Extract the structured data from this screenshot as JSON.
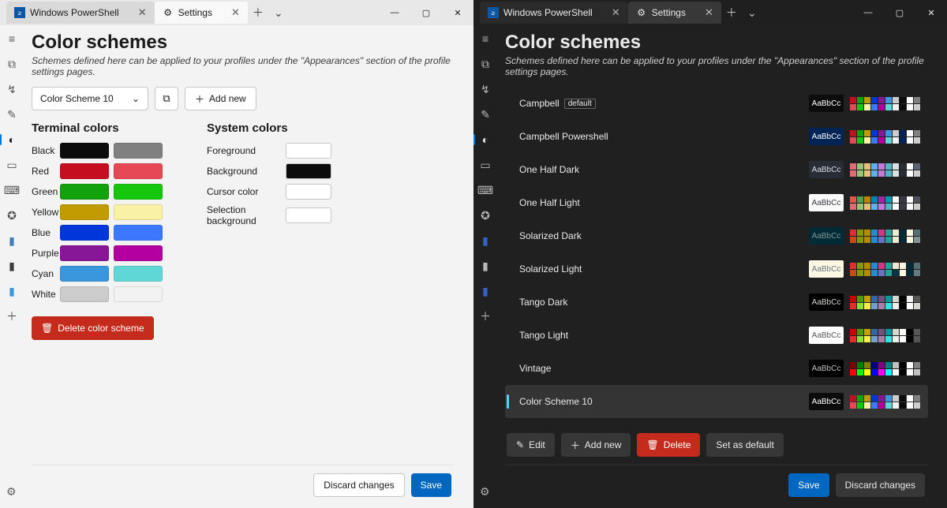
{
  "tabs": {
    "powershell": "Windows PowerShell",
    "settings": "Settings"
  },
  "page": {
    "title": "Color schemes",
    "subtitle": "Schemes defined here can be applied to your profiles under the \"Appearances\" section of the profile settings pages."
  },
  "left": {
    "dropdown_value": "Color Scheme 10",
    "add_new": "Add new",
    "section_terminal": "Terminal colors",
    "section_system": "System colors",
    "terminal_rows": [
      {
        "label": "Black",
        "c1": "#0c0c0c",
        "c2": "#808080"
      },
      {
        "label": "Red",
        "c1": "#c50f1f",
        "c2": "#e74856"
      },
      {
        "label": "Green",
        "c1": "#13a10e",
        "c2": "#16c60c"
      },
      {
        "label": "Yellow",
        "c1": "#c19c00",
        "c2": "#f9f1a5"
      },
      {
        "label": "Blue",
        "c1": "#0037da",
        "c2": "#3b78ff"
      },
      {
        "label": "Purple",
        "c1": "#881798",
        "c2": "#b4009e"
      },
      {
        "label": "Cyan",
        "c1": "#3a96dd",
        "c2": "#61d6d6"
      },
      {
        "label": "White",
        "c1": "#cccccc",
        "c2": "#f2f2f2"
      }
    ],
    "system_rows": [
      {
        "label": "Foreground",
        "color": "#ffffff"
      },
      {
        "label": "Background",
        "color": "#0c0c0c"
      },
      {
        "label": "Cursor color",
        "color": "#ffffff"
      },
      {
        "label": "Selection background",
        "color": "#ffffff"
      }
    ],
    "delete": "Delete color scheme",
    "discard": "Discard changes",
    "save": "Save"
  },
  "right": {
    "schemes": [
      {
        "name": "Campbell",
        "default": true,
        "preview_bg": "#0c0c0c",
        "preview_fg": "#ffffff",
        "palette": [
          "#c50f1f",
          "#13a10e",
          "#c19c00",
          "#0037da",
          "#881798",
          "#3a96dd",
          "#cccccc",
          "#0c0c0c",
          "#ffffff",
          "#808080",
          "#e74856",
          "#16c60c",
          "#f9f1a5",
          "#3b78ff",
          "#b4009e",
          "#61d6d6",
          "#f2f2f2",
          "#0c0c0c",
          "#ffffff",
          "#cccccc"
        ]
      },
      {
        "name": "Campbell Powershell",
        "preview_bg": "#012456",
        "preview_fg": "#ffffff",
        "palette": [
          "#c50f1f",
          "#13a10e",
          "#c19c00",
          "#0037da",
          "#881798",
          "#3a96dd",
          "#cccccc",
          "#012456",
          "#ffffff",
          "#808080",
          "#e74856",
          "#16c60c",
          "#f9f1a5",
          "#3b78ff",
          "#b4009e",
          "#61d6d6",
          "#f2f2f2",
          "#012456",
          "#ffffff",
          "#cccccc"
        ]
      },
      {
        "name": "One Half Dark",
        "preview_bg": "#282c34",
        "preview_fg": "#dcdfe4",
        "palette": [
          "#e06c75",
          "#98c379",
          "#e5c07b",
          "#61afef",
          "#c678dd",
          "#56b6c2",
          "#dcdfe4",
          "#282c34",
          "#ffffff",
          "#5a6374",
          "#e06c75",
          "#98c379",
          "#e5c07b",
          "#61afef",
          "#c678dd",
          "#56b6c2",
          "#dcdfe4",
          "#282c34",
          "#ffffff",
          "#cccccc"
        ]
      },
      {
        "name": "One Half Light",
        "preview_bg": "#fafafa",
        "preview_fg": "#383a42",
        "palette": [
          "#e45649",
          "#50a14f",
          "#c18401",
          "#0184bc",
          "#a626a4",
          "#0997b3",
          "#fafafa",
          "#383a42",
          "#ffffff",
          "#4f525d",
          "#df6c75",
          "#98c379",
          "#e4c07a",
          "#61afef",
          "#c577dd",
          "#56b5c1",
          "#ffffff",
          "#383a42",
          "#ffffff",
          "#cccccc"
        ]
      },
      {
        "name": "Solarized Dark",
        "preview_bg": "#002b36",
        "preview_fg": "#839496",
        "palette": [
          "#dc322f",
          "#859900",
          "#b58900",
          "#268bd2",
          "#d33682",
          "#2aa198",
          "#eee8d5",
          "#002b36",
          "#fdf6e3",
          "#586e75",
          "#cb4b16",
          "#859900",
          "#b58900",
          "#268bd2",
          "#6c71c4",
          "#2aa198",
          "#eee8d5",
          "#002b36",
          "#fdf6e3",
          "#839496"
        ]
      },
      {
        "name": "Solarized Light",
        "preview_bg": "#fdf6e3",
        "preview_fg": "#657b83",
        "palette": [
          "#dc322f",
          "#859900",
          "#b58900",
          "#268bd2",
          "#d33682",
          "#2aa198",
          "#eee8d5",
          "#fdf6e3",
          "#002b36",
          "#586e75",
          "#cb4b16",
          "#859900",
          "#b58900",
          "#268bd2",
          "#6c71c4",
          "#2aa198",
          "#073642",
          "#fdf6e3",
          "#002b36",
          "#657b83"
        ]
      },
      {
        "name": "Tango Dark",
        "preview_bg": "#000000",
        "preview_fg": "#d3d7cf",
        "palette": [
          "#cc0000",
          "#4e9a06",
          "#c4a000",
          "#3465a4",
          "#75507b",
          "#06989a",
          "#d3d7cf",
          "#000000",
          "#eeeeec",
          "#555753",
          "#ef2929",
          "#8ae234",
          "#fce94f",
          "#729fcf",
          "#ad7fa8",
          "#34e2e2",
          "#eeeeec",
          "#000000",
          "#ffffff",
          "#d3d7cf"
        ]
      },
      {
        "name": "Tango Light",
        "preview_bg": "#ffffff",
        "preview_fg": "#555753",
        "palette": [
          "#cc0000",
          "#4e9a06",
          "#c4a000",
          "#3465a4",
          "#75507b",
          "#06989a",
          "#d3d7cf",
          "#ffffff",
          "#000000",
          "#555753",
          "#ef2929",
          "#8ae234",
          "#fce94f",
          "#729fcf",
          "#ad7fa8",
          "#34e2e2",
          "#eeeeec",
          "#ffffff",
          "#000000",
          "#555753"
        ]
      },
      {
        "name": "Vintage",
        "preview_bg": "#000000",
        "preview_fg": "#c0c0c0",
        "palette": [
          "#800000",
          "#008000",
          "#808000",
          "#000080",
          "#800080",
          "#008080",
          "#c0c0c0",
          "#000000",
          "#ffffff",
          "#808080",
          "#ff0000",
          "#00ff00",
          "#ffff00",
          "#0000ff",
          "#ff00ff",
          "#00ffff",
          "#ffffff",
          "#000000",
          "#ffffff",
          "#c0c0c0"
        ]
      },
      {
        "name": "Color Scheme 10",
        "selected": true,
        "preview_bg": "#0c0c0c",
        "preview_fg": "#ffffff",
        "palette": [
          "#c50f1f",
          "#13a10e",
          "#c19c00",
          "#0037da",
          "#881798",
          "#3a96dd",
          "#cccccc",
          "#0c0c0c",
          "#ffffff",
          "#808080",
          "#e74856",
          "#16c60c",
          "#f9f1a5",
          "#3b78ff",
          "#b4009e",
          "#61d6d6",
          "#f2f2f2",
          "#0c0c0c",
          "#ffffff",
          "#cccccc"
        ]
      }
    ],
    "actions": {
      "edit": "Edit",
      "add": "Add new",
      "delete": "Delete",
      "set_default": "Set as default"
    },
    "discard": "Discard changes",
    "save": "Save",
    "default_badge": "default",
    "preview_text": "AaBbCc"
  }
}
